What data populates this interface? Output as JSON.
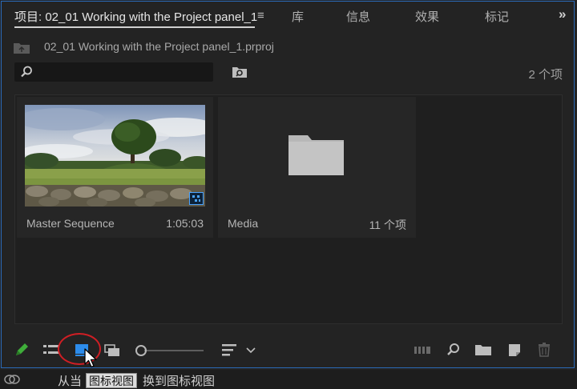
{
  "tabs": [
    {
      "label": "项目: 02_01 Working with the Project panel_1",
      "active": true
    },
    {
      "label": "库"
    },
    {
      "label": "信息"
    },
    {
      "label": "效果"
    },
    {
      "label": "标记"
    }
  ],
  "tab_menu_glyph": "≡",
  "tab_overflow_glyph": "»",
  "project_path": "02_01 Working with the Project panel_1.prproj",
  "search": {
    "placeholder": "",
    "value": ""
  },
  "item_count": "2 个项",
  "items": [
    {
      "name": "Master Sequence",
      "meta": "1:05:03",
      "type": "sequence"
    },
    {
      "name": "Media",
      "meta": "11 个项",
      "type": "bin"
    }
  ],
  "status": {
    "text_before": "从当",
    "tooltip": "图标视图",
    "text_after": "换到图标视图"
  },
  "colors": {
    "accent": "#2a6ab8",
    "active_view_button": "#2d8ceb",
    "highlight_circle": "#d01e24",
    "write_on_icon": "#3fae3a"
  },
  "icons": [
    "bin-up-icon",
    "search-icon",
    "new-bin-icon",
    "pencil-icon",
    "list-view-icon",
    "icon-view-icon",
    "freeform-view-icon",
    "sort-icon",
    "chevron-down-icon",
    "automate-to-sequence-icon",
    "find-icon",
    "new-folder-icon",
    "new-item-icon",
    "trash-icon"
  ]
}
